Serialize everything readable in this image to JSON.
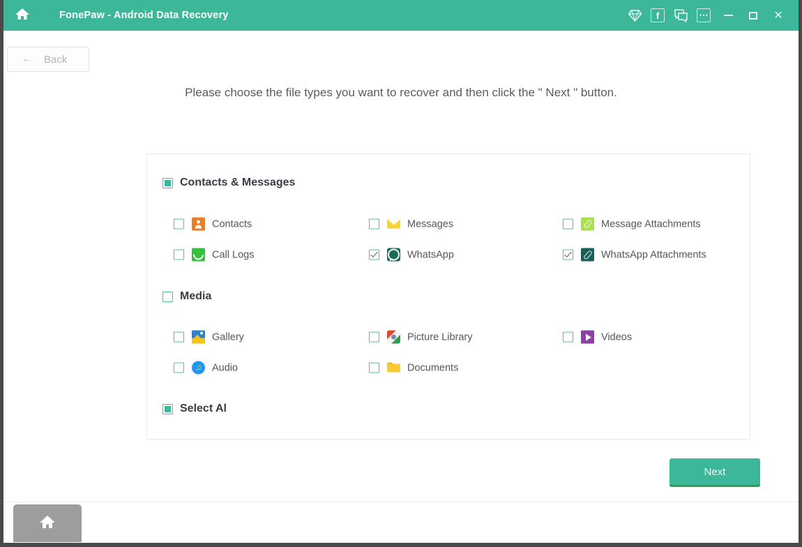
{
  "window": {
    "title": "FonePaw - Android Data Recovery",
    "home_icon": "home-icon",
    "accent_color": "#3cb79a",
    "titlebar_icons": [
      {
        "name": "diamond-icon",
        "glyph": "◆"
      },
      {
        "name": "facebook-icon",
        "glyph": "f"
      },
      {
        "name": "feedback-icon",
        "glyph": "⧉"
      },
      {
        "name": "more-options-icon",
        "glyph": "⋯"
      }
    ],
    "controls": {
      "minimize": "minimize-button",
      "maximize": "maximize-button",
      "close_glyph": "✕"
    }
  },
  "navbar": {
    "back_arrow": "←",
    "back_label": "Back"
  },
  "main": {
    "instruction": "Please choose the file types you want to recover and then click the \" Next \" button."
  },
  "groups": [
    {
      "id": "contacts-messages",
      "label": "Contacts & Messages",
      "state": "indeterminate",
      "items": [
        {
          "label": "Contacts",
          "icon": "contacts-icon",
          "checked": false
        },
        {
          "label": "Messages",
          "icon": "messages-icon",
          "checked": false
        },
        {
          "label": "Message Attachments",
          "icon": "message-attachments-icon",
          "checked": false
        },
        {
          "label": "Call Logs",
          "icon": "call-logs-icon",
          "checked": false
        },
        {
          "label": "WhatsApp",
          "icon": "whatsapp-icon",
          "checked": true
        },
        {
          "label": "WhatsApp Attachments",
          "icon": "whatsapp-attachments-icon",
          "checked": true
        }
      ]
    },
    {
      "id": "media",
      "label": "Media",
      "state": "unchecked",
      "items": [
        {
          "label": "Gallery",
          "icon": "gallery-icon",
          "checked": false
        },
        {
          "label": "Picture Library",
          "icon": "picture-library-icon",
          "checked": false
        },
        {
          "label": "Videos",
          "icon": "videos-icon",
          "checked": false
        },
        {
          "label": "Audio",
          "icon": "audio-icon",
          "checked": false
        },
        {
          "label": "Documents",
          "icon": "documents-icon",
          "checked": false
        }
      ]
    }
  ],
  "select_all": {
    "label": "Select Al",
    "state": "indeterminate"
  },
  "footer": {
    "next_label": "Next"
  },
  "taskbar": {
    "home_tab_icon": "home-icon"
  }
}
